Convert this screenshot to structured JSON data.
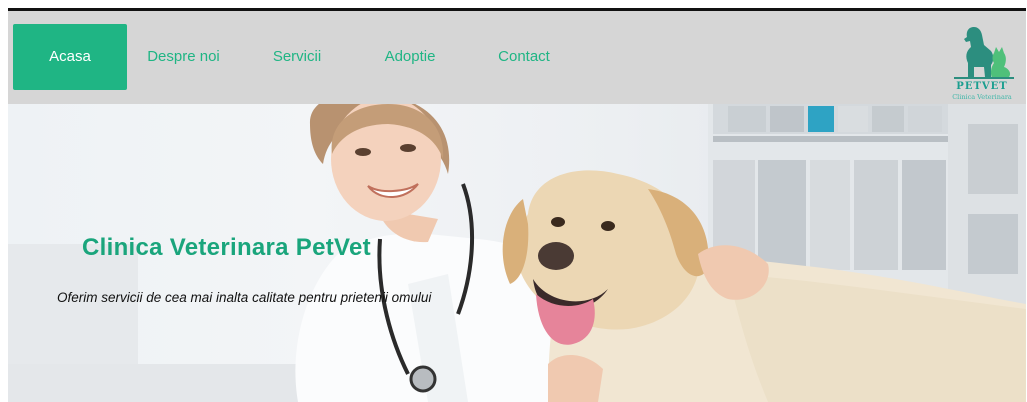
{
  "nav": {
    "items": [
      {
        "label": "Acasa",
        "active": true
      },
      {
        "label": "Despre noi",
        "active": false
      },
      {
        "label": "Servicii",
        "active": false
      },
      {
        "label": "Adoptie",
        "active": false
      },
      {
        "label": "Contact",
        "active": false
      }
    ]
  },
  "logo": {
    "brand": "PETVET",
    "subtitle": "Clinica Veterinara",
    "icon": "dog-cat-silhouette-icon"
  },
  "hero": {
    "title": "Clinica Veterinara PetVet",
    "subtitle": "Oferim servicii de cea mai inalta calitate pentru prietenii omului",
    "image": "veterinarian-with-labrador-photo"
  },
  "colors": {
    "accent": "#1fb584",
    "navbar_bg": "#d6d6d6",
    "logo_teal": "#1a9e8f"
  }
}
